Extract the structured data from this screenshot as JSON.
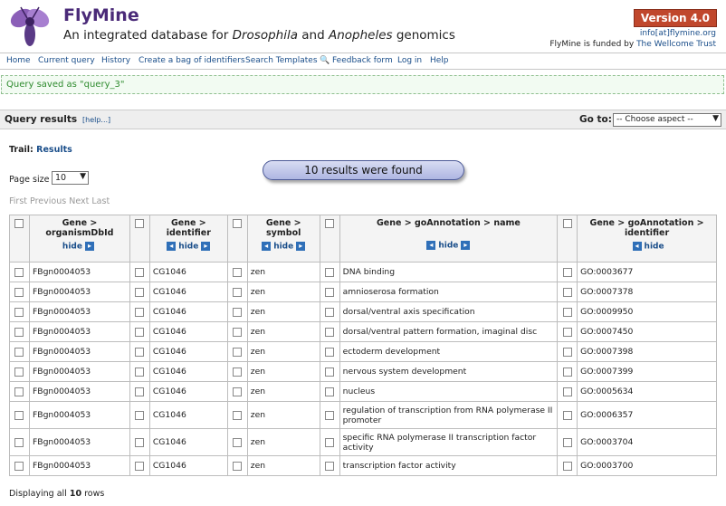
{
  "header": {
    "brand": "FlyMine",
    "tagline_pre": "An integrated database for ",
    "tagline_em1": "Drosophila",
    "tagline_mid": " and ",
    "tagline_em2": "Anopheles",
    "tagline_post": " genomics",
    "version": "Version 4.0",
    "contact": "info[at]flymine.org",
    "funded_pre": "FlyMine is funded by ",
    "funded_link": "The Wellcome Trust"
  },
  "nav": {
    "items": [
      "Home",
      "Current query",
      "History",
      "Create a bag of identifiers",
      "Search Templates",
      "Feedback form",
      "Log in",
      "Help"
    ]
  },
  "message": "Query saved as \"query_3\"",
  "section": {
    "title": "Query results",
    "help": "[help...]",
    "goto_label": "Go to:",
    "goto_value": "-- Choose aspect --"
  },
  "trail": {
    "label": "Trail:",
    "link": "Results"
  },
  "results_found": "10 results were found",
  "page_size": {
    "label": "Page size",
    "value": "10"
  },
  "pager": {
    "first": "First",
    "previous": "Previous",
    "next": "Next",
    "last": "Last"
  },
  "table": {
    "hide_label": "hide",
    "columns": [
      {
        "line1": "Gene >",
        "line2": "organismDbId"
      },
      {
        "line1": "Gene >",
        "line2": "identifier"
      },
      {
        "line1": "Gene >",
        "line2": "symbol"
      },
      {
        "line1": "Gene > goAnnotation > name",
        "line2": ""
      },
      {
        "line1": "Gene > goAnnotation >",
        "line2": "identifier"
      }
    ],
    "rows": [
      [
        "FBgn0004053",
        "CG1046",
        "zen",
        "DNA binding",
        "GO:0003677"
      ],
      [
        "FBgn0004053",
        "CG1046",
        "zen",
        "amnioserosa formation",
        "GO:0007378"
      ],
      [
        "FBgn0004053",
        "CG1046",
        "zen",
        "dorsal/ventral axis specification",
        "GO:0009950"
      ],
      [
        "FBgn0004053",
        "CG1046",
        "zen",
        "dorsal/ventral pattern formation, imaginal disc",
        "GO:0007450"
      ],
      [
        "FBgn0004053",
        "CG1046",
        "zen",
        "ectoderm development",
        "GO:0007398"
      ],
      [
        "FBgn0004053",
        "CG1046",
        "zen",
        "nervous system development",
        "GO:0007399"
      ],
      [
        "FBgn0004053",
        "CG1046",
        "zen",
        "nucleus",
        "GO:0005634"
      ],
      [
        "FBgn0004053",
        "CG1046",
        "zen",
        "regulation of transcription from RNA polymerase II promoter",
        "GO:0006357"
      ],
      [
        "FBgn0004053",
        "CG1046",
        "zen",
        "specific RNA polymerase II transcription factor activity",
        "GO:0003704"
      ],
      [
        "FBgn0004053",
        "CG1046",
        "zen",
        "transcription factor activity",
        "GO:0003700"
      ]
    ]
  },
  "footer": {
    "pre": "Displaying all ",
    "count": "10",
    "post": " rows"
  }
}
